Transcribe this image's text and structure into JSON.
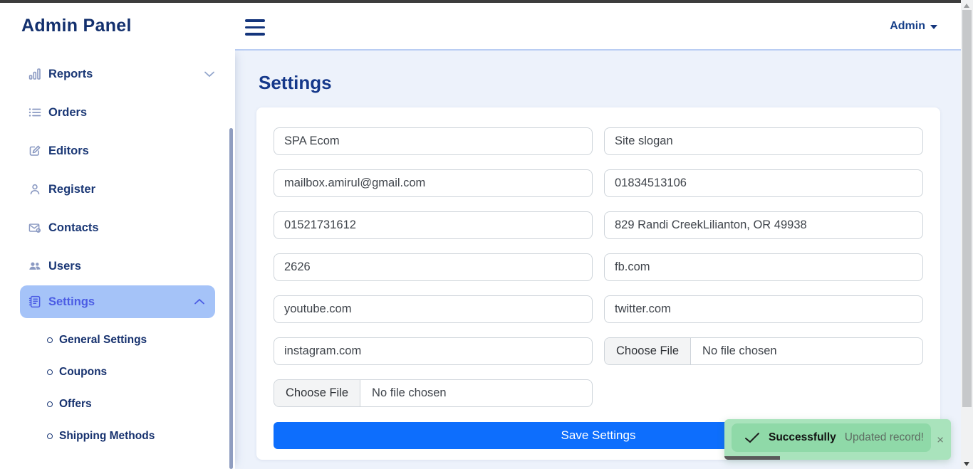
{
  "header": {
    "brand": "Admin Panel",
    "user_menu": "Admin"
  },
  "sidebar": {
    "items": [
      {
        "label": "Reports",
        "icon": "bar-chart-icon",
        "chevron": "down",
        "active": false
      },
      {
        "label": "Orders",
        "icon": "list-icon",
        "active": false
      },
      {
        "label": "Editors",
        "icon": "edit-icon",
        "active": false
      },
      {
        "label": "Register",
        "icon": "person-icon",
        "active": false
      },
      {
        "label": "Contacts",
        "icon": "mail-at-icon",
        "active": false
      },
      {
        "label": "Users",
        "icon": "users-icon",
        "active": false
      },
      {
        "label": "Settings",
        "icon": "journal-icon",
        "chevron": "up",
        "active": true
      }
    ],
    "settings_children": [
      {
        "label": "General Settings"
      },
      {
        "label": "Coupons"
      },
      {
        "label": "Offers"
      },
      {
        "label": "Shipping Methods"
      }
    ]
  },
  "main": {
    "title": "Settings",
    "form": {
      "fields": [
        {
          "value": "SPA Ecom"
        },
        {
          "value": "Site slogan"
        },
        {
          "value": "mailbox.amirul@gmail.com"
        },
        {
          "value": "01834513106"
        },
        {
          "value": "01521731612"
        },
        {
          "value": "829 Randi CreekLilianton, OR 49938"
        },
        {
          "value": "2626"
        },
        {
          "value": "fb.com"
        },
        {
          "value": "youtube.com"
        },
        {
          "value": "twitter.com"
        },
        {
          "value": "instagram.com"
        }
      ],
      "file_inputs": [
        {
          "button": "Choose File",
          "status": "No file chosen"
        },
        {
          "button": "Choose File",
          "status": "No file chosen"
        }
      ],
      "save_button": "Save Settings"
    }
  },
  "toast": {
    "title": "Successfully",
    "message": "Updated record!",
    "close": "×"
  },
  "colors": {
    "accent_blue": "#0d6efd",
    "navy": "#13306e",
    "active_item_bg": "#a5c3f8",
    "active_item_text": "#4b5ce4",
    "toast_green_outer": "#a9e3bc",
    "toast_green_inner": "#8fd9a8",
    "content_bg": "#edf2fb"
  }
}
